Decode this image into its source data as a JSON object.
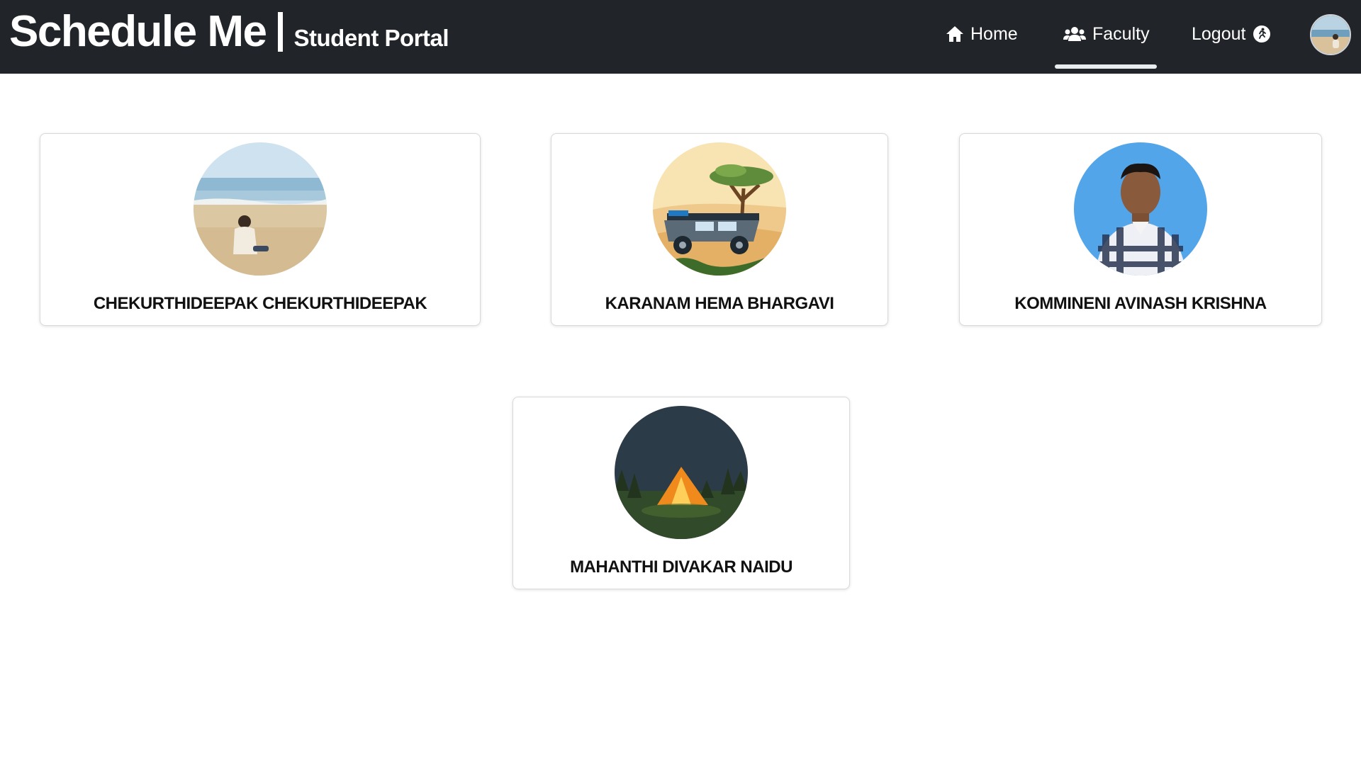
{
  "header": {
    "app_title": "Schedule Me",
    "subtitle": "Student Portal",
    "nav": {
      "home": "Home",
      "faculty": "Faculty",
      "logout": "Logout"
    },
    "active_tab": "faculty",
    "background": "#212529"
  },
  "faculty": [
    {
      "name": "CHEKURTHIDEEPAK CHEKURTHIDEEPAK",
      "photo": "beach-photo"
    },
    {
      "name": "KARANAM HEMA BHARGAVI",
      "photo": "safari-jeep-illustration"
    },
    {
      "name": "KOMMINENI AVINASH KRISHNA",
      "photo": "portrait-photo"
    },
    {
      "name": "MAHANTHI DIVAKAR NAIDU",
      "photo": "tent-night-illustration"
    }
  ],
  "icons": {
    "home": "home-icon",
    "faculty": "users-icon",
    "logout": "running-exit-icon",
    "profile": "profile-avatar"
  }
}
